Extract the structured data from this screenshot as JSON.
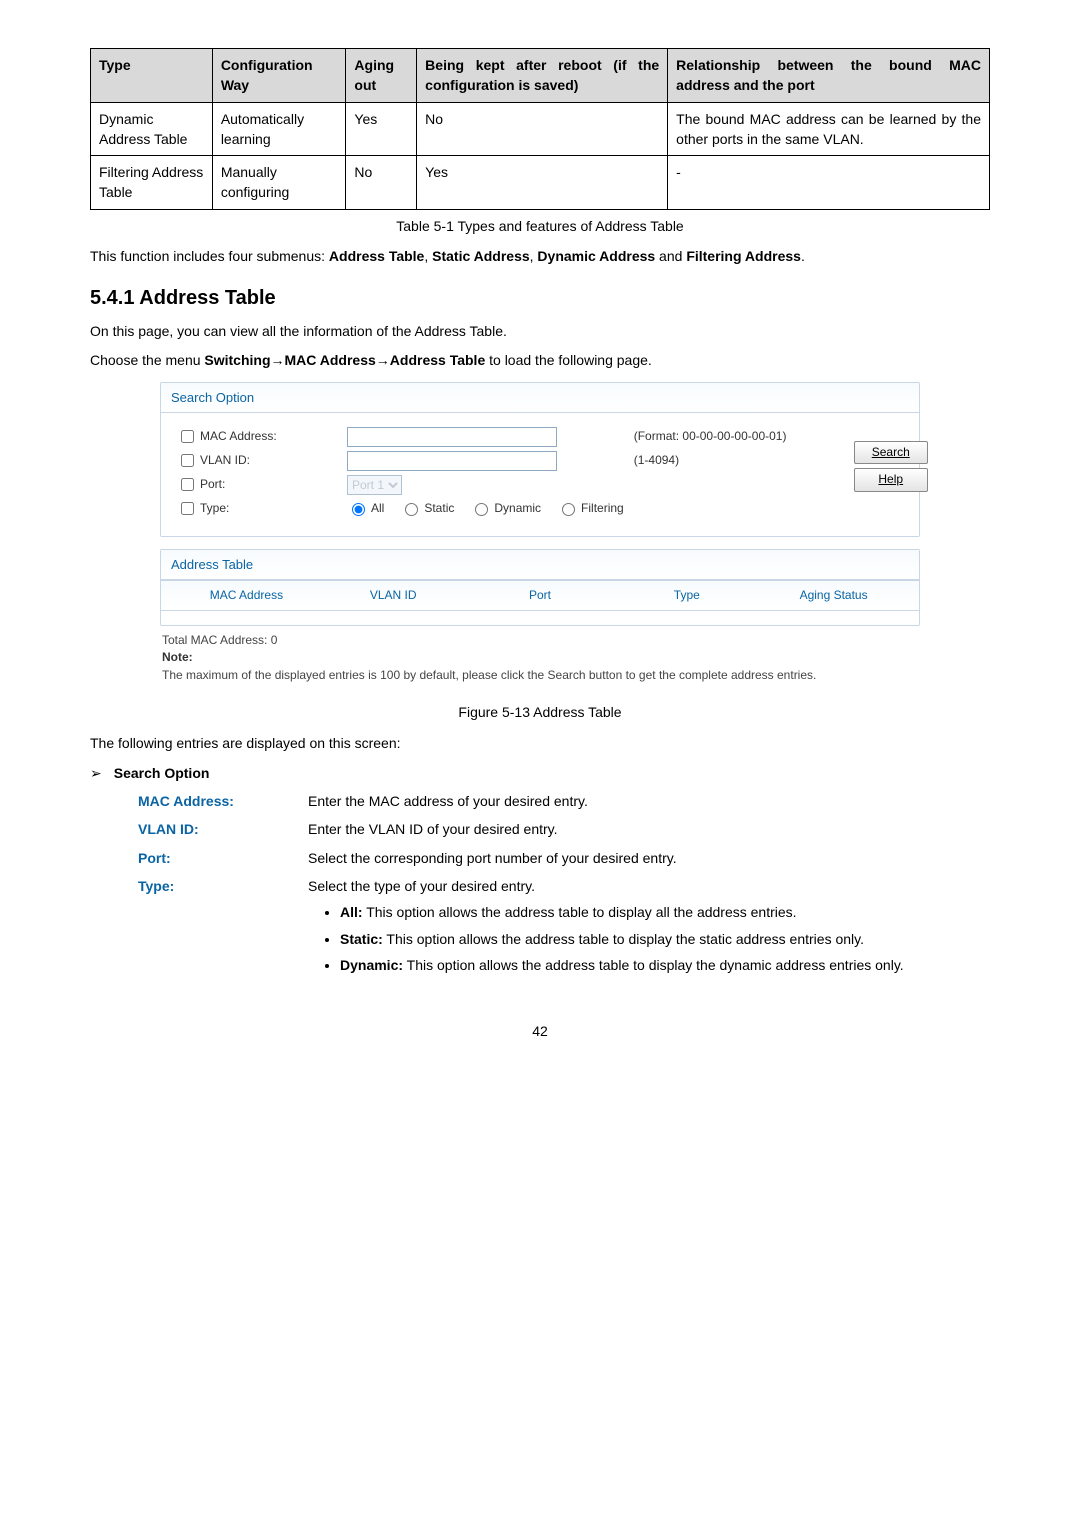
{
  "mainTable": {
    "headers": [
      "Type",
      "Configuration Way",
      "Aging out",
      "Being kept after reboot\n(if the configuration is saved)",
      "Relationship between the bound MAC address and the port"
    ],
    "rows": [
      {
        "type": "Dynamic Address Table",
        "cfg": "Automatically learning",
        "aging": "Yes",
        "reboot": "No",
        "rel": "The bound MAC address can be learned by the other ports in the same VLAN."
      },
      {
        "type": "Filtering Address Table",
        "cfg": "Manually configuring",
        "aging": "No",
        "reboot": "Yes",
        "rel": "-"
      }
    ],
    "caption": "Table 5-1 Types and features of Address Table"
  },
  "intro": {
    "p1_a": "This function includes four submenus: ",
    "p1_b": "Address Table",
    "p1_c": ", ",
    "p1_d": "Static Address",
    "p1_e": ", ",
    "p1_f": "Dynamic Address",
    "p1_g": " and ",
    "p1_h": "Filtering Address",
    "p1_i": "."
  },
  "section": "5.4.1 Address Table",
  "para2": "On this page, you can view all the information of the Address Table.",
  "para3_a": "Choose the menu ",
  "para3_b": "Switching→MAC Address→Address Table",
  "para3_c": " to load the following page.",
  "searchPanel": {
    "title": "Search Option",
    "macLabel": "MAC Address:",
    "macHint": "(Format: 00-00-00-00-00-01)",
    "vlanLabel": "VLAN ID:",
    "vlanHint": "(1-4094)",
    "portLabel": "Port:",
    "portOption": "Port 1",
    "typeLabel": "Type:",
    "typeAll": "All",
    "typeStatic": "Static",
    "typeDynamic": "Dynamic",
    "typeFiltering": "Filtering",
    "btnSearch": "Search",
    "btnHelp": "Help"
  },
  "addrTable": {
    "title": "Address Table",
    "colMac": "MAC Address",
    "colVlan": "VLAN ID",
    "colPort": "Port",
    "colType": "Type",
    "colAging": "Aging Status"
  },
  "noteBlock": {
    "total": "Total MAC Address: 0",
    "noteLabel": "Note:",
    "noteText": "The maximum of the displayed entries is 100 by default, please click the Search button to get the complete address entries."
  },
  "figCaption": "Figure 5-13 Address Table",
  "followPara": "The following entries are displayed on this screen:",
  "arrowHead": "Search Option",
  "defs": {
    "mac": {
      "label": "MAC Address:",
      "text": "Enter the MAC address of your desired entry."
    },
    "vlan": {
      "label": "VLAN ID:",
      "text": "Enter the VLAN ID of your desired entry."
    },
    "port": {
      "label": "Port:",
      "text": "Select the corresponding port number of your desired entry."
    },
    "type": {
      "label": "Type:",
      "text": "Select the type of your desired entry.",
      "bullets": [
        {
          "b": "All:",
          "t": " This option allows the address table to display all the address entries."
        },
        {
          "b": "Static:",
          "t": " This option allows the address table to display the static address entries only."
        },
        {
          "b": "Dynamic:",
          "t": " This option allows the address table to display the dynamic address entries only."
        }
      ]
    }
  },
  "pageNumber": "42"
}
